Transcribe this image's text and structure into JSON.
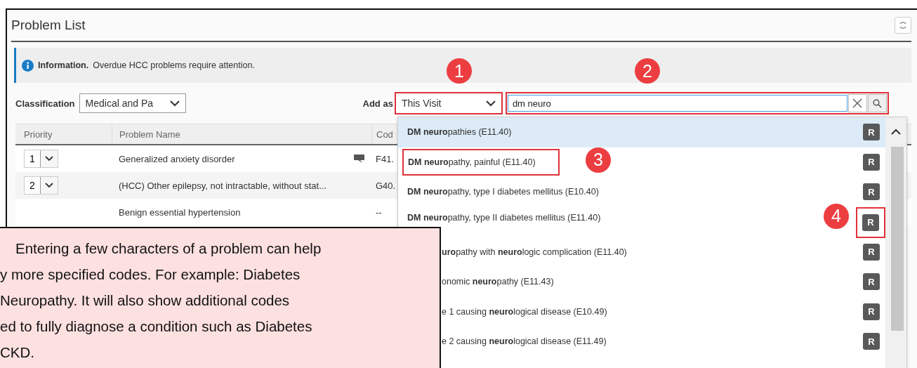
{
  "panel": {
    "title": "Problem List"
  },
  "info": {
    "label": "Information.",
    "message": "Overdue HCC problems require attention."
  },
  "classification": {
    "label": "Classification",
    "value": "Medical and Pa"
  },
  "add_as": {
    "label": "Add as",
    "value": "This Visit"
  },
  "search": {
    "value": "dm neuro"
  },
  "table": {
    "columns": [
      "Priority",
      "Problem Name",
      "Cod"
    ],
    "rows": [
      {
        "priority": "1",
        "name": "Generalized anxiety disorder",
        "comment": true,
        "code": "F41."
      },
      {
        "priority": "2",
        "name": "(HCC) Other epilepsy, not intractable, without stat...",
        "comment": false,
        "code": "G40."
      },
      {
        "name": "Benign essential hypertension",
        "comment": false,
        "code": "--"
      }
    ]
  },
  "results": [
    {
      "text": "**DM neuro**pathies (E11.40)",
      "selected": true,
      "clipped": false,
      "action": "R"
    },
    {
      "text": "**DM neuro**pathy, painful (E11.40)",
      "selected": false,
      "clipped": false,
      "action": "R"
    },
    {
      "text": "**DM neuro**pathy, type I diabetes mellitus (E10.40)",
      "selected": false,
      "clipped": false,
      "action": "R"
    },
    {
      "text": "**DM neuro**pathy, type II diabetes mellitus (E11.40)",
      "selected": false,
      "clipped": false,
      "action": "R"
    },
    {
      "text": "**uro**pathy with **neuro**logic complication (E11.40)",
      "selected": false,
      "clipped": true,
      "action": "R"
    },
    {
      "text": "onomic **neuro**pathy (E11.43)",
      "selected": false,
      "clipped": true,
      "action": "R"
    },
    {
      "text": "e 1 causing **neuro**logical disease (E10.49)",
      "selected": false,
      "clipped": true,
      "action": "R"
    },
    {
      "text": "e 2 causing **neuro**logical disease (E11.49)",
      "selected": false,
      "clipped": true,
      "action": "R"
    }
  ],
  "annotations": [
    {
      "number": "1"
    },
    {
      "number": "2"
    },
    {
      "number": "3"
    },
    {
      "number": "4"
    }
  ],
  "callout": {
    "lines": [
      "Entering a few characters of a problem can help",
      "y more specified codes. For example: Diabetes",
      "Neuropathy. It will also show additional codes",
      "ed to fully diagnose a condition such as Diabetes",
      "CKD."
    ]
  }
}
